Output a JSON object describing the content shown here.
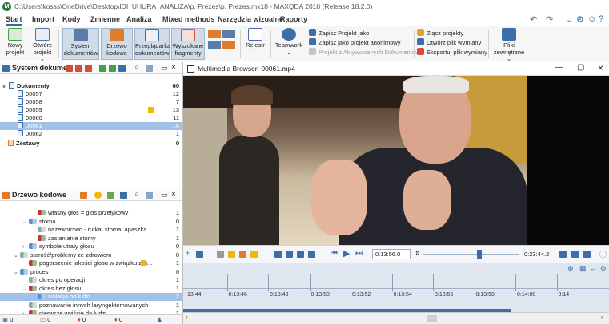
{
  "window": {
    "title": "C:\\Users\\kosss\\OneDrive\\Desktop\\IDI_UHURA_ANALIZA\\p. Prezes\\p. Prezes.mx18 - MAXQDA 2018 (Release 18.2.0)",
    "app_badge": "M"
  },
  "menu": [
    "Start",
    "Import",
    "Kody",
    "Zmienne",
    "Analiza",
    "Mixed methods",
    "Narzędzia wizualne",
    "Raporty"
  ],
  "ribbon": {
    "nowy": [
      "Nowy",
      "projekt"
    ],
    "otworz": [
      "Otwórz",
      "projekt ⌄"
    ],
    "system": [
      "System",
      "dokumentów"
    ],
    "drzewo": [
      "Drzewo",
      "kodowe"
    ],
    "przegladarka": [
      "Przeglądarka",
      "dokumentów"
    ],
    "wyszukane": [
      "Wyszukane",
      "fragmenty"
    ],
    "rejestr": "Rejestr",
    "teamwork": [
      "Teamwork",
      "⌄"
    ],
    "zapisz_jako": "Zapisz Projekt jako",
    "zapisz_anon": "Zapisz jako projekt anonimowy",
    "projekt_z_akt": "Projekt z Aktywowanych Dokumentów",
    "zlacz": "Złącz projekty",
    "otworz_plik": "Otwórz plik wymiany",
    "eksportuj": "Eksportuj plik wymiany",
    "pliki": [
      "Pliki",
      "zewnętrzne ⌄"
    ]
  },
  "doc_panel": {
    "title": "System dokume...",
    "root": {
      "label": "Dokumenty",
      "count": "60"
    },
    "items": [
      {
        "label": "00057",
        "count": "12"
      },
      {
        "label": "00058",
        "count": "7"
      },
      {
        "label": "00059",
        "count": "13"
      },
      {
        "label": "00060",
        "count": "11"
      },
      {
        "label": "00061",
        "count": "16"
      },
      {
        "label": "00062",
        "count": "1"
      }
    ],
    "sets": "Zestawy",
    "sets_count": "0"
  },
  "code_panel": {
    "title": "Drzewo kodowe",
    "items": [
      {
        "label": "własny głos = głos przełykowy",
        "count": "1",
        "indent": 3,
        "caret": ""
      },
      {
        "label": "stoma",
        "count": "0",
        "indent": 2,
        "caret": "v"
      },
      {
        "label": "nazewnictwo - rurka, stoma, apaszka",
        "count": "1",
        "indent": 3,
        "caret": ""
      },
      {
        "label": "zasłanianie stomy",
        "count": "1",
        "indent": 3,
        "caret": ""
      },
      {
        "label": "symbole utraty głosu",
        "count": "0",
        "indent": 2,
        "caret": ">"
      },
      {
        "label": "starość/problemy ze zdrowiem",
        "count": "0",
        "indent": 1,
        "caret": "v"
      },
      {
        "label": "pogorszenie jakości głosu w związku z w...",
        "count": "1",
        "indent": 2,
        "caret": ""
      },
      {
        "label": "proces",
        "count": "0",
        "indent": 1,
        "caret": "v"
      },
      {
        "label": "okres po operacji",
        "count": "1",
        "indent": 2,
        "caret": ""
      },
      {
        "label": "okres bez głosu",
        "count": "1",
        "indent": 2,
        "caret": "v"
      },
      {
        "label": "izolacja od ludzi",
        "count": "2",
        "indent": 3,
        "caret": ""
      },
      {
        "label": "poznawanie innych laryngektomowanych",
        "count": "1",
        "indent": 2,
        "caret": ""
      },
      {
        "label": "pierwsze wyjście do ludzi",
        "count": "1",
        "indent": 2,
        "caret": ">"
      }
    ]
  },
  "status": [
    "0",
    "0",
    "0",
    "0",
    "0"
  ],
  "video": {
    "title": "Multimedia Browser: 00061.mp4",
    "current_time": "0:13:56.0",
    "total_time": "0:23:44.2",
    "progress_fraction": 0.587,
    "ticks": [
      "13:44",
      "0:13:46",
      "0:13:48",
      "0:13:50",
      "0:13:52",
      "0:13:54",
      "0:13:56",
      "0:13:58",
      "0:14:00",
      "0:14"
    ]
  }
}
